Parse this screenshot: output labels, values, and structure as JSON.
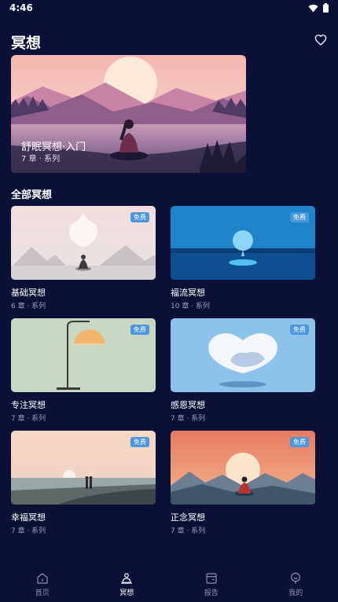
{
  "status": {
    "time": "4:46"
  },
  "header": {
    "title": "冥想"
  },
  "hero": {
    "title": "舒眠冥想·入门",
    "subtitle": "7 章 · 系列"
  },
  "section": {
    "title": "全部冥想"
  },
  "badge_label": "免费",
  "cards": [
    {
      "title": "基础冥想",
      "subtitle": "6 章 · 系列"
    },
    {
      "title": "福流冥想",
      "subtitle": "10 章 · 系列"
    },
    {
      "title": "专注冥想",
      "subtitle": "7 章 · 系列"
    },
    {
      "title": "感恩冥想",
      "subtitle": "7 章 · 系列"
    },
    {
      "title": "幸福冥想",
      "subtitle": "7 章 · 系列"
    },
    {
      "title": "正念冥想",
      "subtitle": "7 章 · 系列"
    }
  ],
  "nav": {
    "items": [
      {
        "label": "首页",
        "icon": "home-icon"
      },
      {
        "label": "冥想",
        "icon": "meditation-icon"
      },
      {
        "label": "报告",
        "icon": "report-icon"
      },
      {
        "label": "我的",
        "icon": "profile-icon"
      }
    ],
    "active_index": 1
  },
  "colors": {
    "background": "#0b1136",
    "badge": "#4a97dd",
    "nav_active": "#ffffff",
    "nav_inactive": "#8c92ad"
  }
}
